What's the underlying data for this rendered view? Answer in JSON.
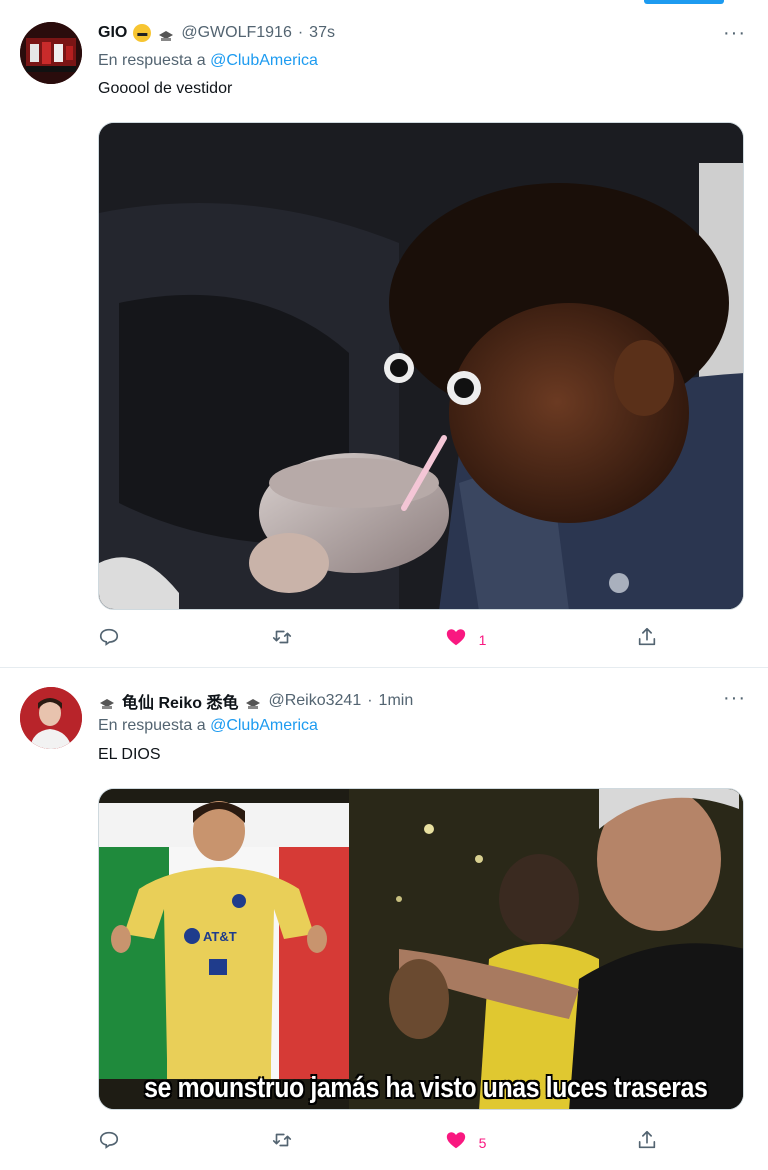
{
  "tweets": [
    {
      "display_name": "GIO",
      "handle": "@GWOLF1916",
      "separator": "·",
      "time": "37s",
      "reply_prefix": "En respuesta a",
      "reply_mention": "@ClubAmerica",
      "text": "Gooool de vestidor",
      "more_label": "···",
      "likes": "1"
    },
    {
      "display_name": "龟仙 Reiko 悉龟",
      "handle": "@Reiko3241",
      "separator": "·",
      "time": "1min",
      "reply_prefix": "En respuesta a",
      "reply_mention": "@ClubAmerica",
      "text": "EL DIOS",
      "more_label": "···",
      "likes": "5",
      "media_caption": "se mounstruo jamás ha visto unas luces traseras",
      "jersey_sponsor": "AT&T"
    }
  ],
  "icons": {
    "reply": "comment-icon",
    "retweet": "retweet-icon",
    "like": "heart-icon",
    "share": "share-icon",
    "more": "more-icon"
  },
  "colors": {
    "accent": "#1d9bf0",
    "like": "#f91880",
    "secondary_text": "#536471"
  }
}
